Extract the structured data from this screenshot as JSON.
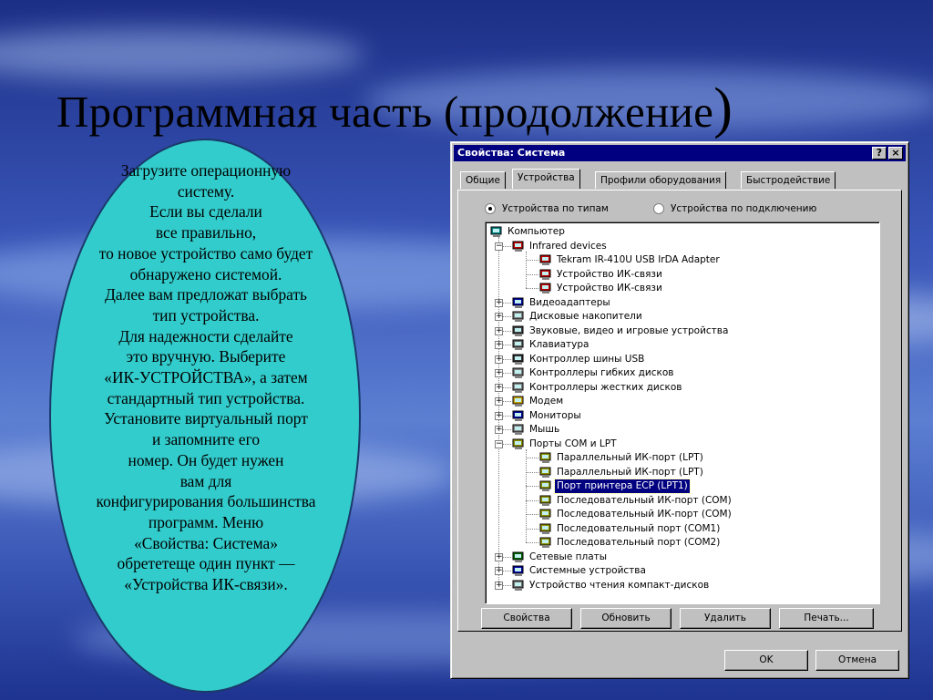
{
  "slide": {
    "title": "Программная часть (продолжение",
    "title_paren": ")",
    "instructions": [
      "Загрузите операционную",
      "систему.",
      "Если вы сделали",
      "все правильно,",
      "то новое устройство само будет",
      "обнаружено системой.",
      "Далее вам предложат выбрать",
      "тип устройства.",
      "Для надежности сделайте",
      "это вручную. Выберите",
      "«ИК-УСТРОЙСТВА», а затем",
      "стандартный тип устройства.",
      "Установите виртуальный порт",
      "и запомните его",
      "номер. Он будет нужен",
      "вам для",
      "конфигурирования большинства",
      "программ. Меню",
      "«Свойства: Система»",
      "обрететеще один пункт —",
      "«Устройства ИК-связи»."
    ]
  },
  "dialog": {
    "title": "Свойства: Система",
    "help_button": "?",
    "close_button": "×",
    "tabs": [
      "Общие",
      "Устройства",
      "Профили оборудования",
      "Быстродействие"
    ],
    "active_tab": "Устройства",
    "radio_by_type": "Устройства по типам",
    "radio_by_connection": "Устройства по подключению",
    "tree": [
      {
        "label": "Компьютер",
        "icon": "computer-icon"
      },
      {
        "label": "Infrared devices",
        "icon": "infrared-icon"
      },
      {
        "label": "Tekram IR-410U USB IrDA Adapter",
        "icon": "infrared-icon"
      },
      {
        "label": "Устройство ИК-связи",
        "icon": "infrared-icon"
      },
      {
        "label": "Устройство ИК-связи",
        "icon": "infrared-icon"
      },
      {
        "label": "Видеоадаптеры",
        "icon": "display-adapter-icon"
      },
      {
        "label": "Дисковые накопители",
        "icon": "disk-drive-icon"
      },
      {
        "label": "Звуковые, видео и игровые устройства",
        "icon": "sound-icon"
      },
      {
        "label": "Клавиатура",
        "icon": "keyboard-icon"
      },
      {
        "label": "Контроллер шины USB",
        "icon": "usb-icon"
      },
      {
        "label": "Контроллеры гибких дисков",
        "icon": "floppy-controller-icon"
      },
      {
        "label": "Контроллеры жестких дисков",
        "icon": "hdd-controller-icon"
      },
      {
        "label": "Модем",
        "icon": "modem-icon"
      },
      {
        "label": "Мониторы",
        "icon": "monitor-icon"
      },
      {
        "label": "Мышь",
        "icon": "mouse-icon"
      },
      {
        "label": "Порты COM и LPT",
        "icon": "port-icon"
      },
      {
        "label": "Параллельный ИК-порт (LPT)",
        "icon": "port-icon"
      },
      {
        "label": "Параллельный ИК-порт (LPT)",
        "icon": "port-icon"
      },
      {
        "label": "Порт принтера ECP (LPT1)",
        "icon": "port-icon"
      },
      {
        "label": "Последовательный ИК-порт (COM)",
        "icon": "port-icon"
      },
      {
        "label": "Последовательный ИК-порт (COM)",
        "icon": "port-icon"
      },
      {
        "label": "Последовательный порт (COM1)",
        "icon": "port-icon"
      },
      {
        "label": "Последовательный порт (COM2)",
        "icon": "port-icon"
      },
      {
        "label": "Сетевые платы",
        "icon": "network-card-icon"
      },
      {
        "label": "Системные устройства",
        "icon": "system-devices-icon"
      },
      {
        "label": "Устройство чтения компакт-дисков",
        "icon": "cdrom-icon"
      }
    ],
    "selected_item": "Порт принтера ECP (LPT1)",
    "buttons": {
      "properties": "Свойства",
      "refresh": "Обновить",
      "remove": "Удалить",
      "print": "Печать...",
      "ok": "OK",
      "cancel": "Отмена"
    }
  },
  "colors": {
    "title_bar": "#000080",
    "window_face": "#c0c0c0",
    "oval_fill": "#33cccc",
    "background_blue": "#2a3f9e"
  }
}
